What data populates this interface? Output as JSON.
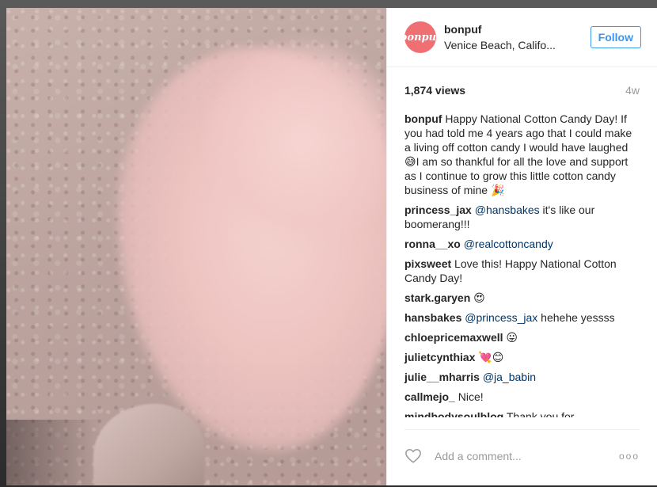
{
  "post": {
    "username": "bonpuf",
    "avatar_text": "bonpuf",
    "location": "Venice Beach, Califo...",
    "follow_label": "Follow",
    "views": "1,874 views",
    "age": "4w"
  },
  "comments": [
    {
      "author": "bonpuf",
      "text": "Happy National Cotton Candy Day! If you had told me 4 years ago that I could make a living off cotton candy I would have laughed 😅I am so thankful for all the love and support as I continue to grow this little cotton candy business of mine 🎉"
    },
    {
      "author": "princess_jax",
      "mention": "@hansbakes",
      "text": " it's like our boomerang!!!"
    },
    {
      "author": "ronna__xo",
      "mention": "@realcottoncandy",
      "text": ""
    },
    {
      "author": "pixsweet",
      "text": "Love this! Happy National Cotton Candy Day!"
    },
    {
      "author": "stark.garyen",
      "text": "😍"
    },
    {
      "author": "hansbakes",
      "mention": "@princess_jax",
      "text": " hehehe yessss"
    },
    {
      "author": "chloepricemaxwell",
      "text": "😛"
    },
    {
      "author": "julietcynthiax",
      "text": "💘😊"
    },
    {
      "author": "julie__mharris",
      "mention": "@ja_babin",
      "text": ""
    },
    {
      "author": "callmejo_",
      "text": "Nice!"
    },
    {
      "author": "mindbodysoulblog",
      "text": "Thank you for"
    }
  ],
  "footer": {
    "add_comment_placeholder": "Add a comment...",
    "more_label": "ooo"
  },
  "colors": {
    "follow_blue": "#3897f0",
    "mention_blue": "#003569",
    "avatar_pink": "#ef6f73"
  }
}
